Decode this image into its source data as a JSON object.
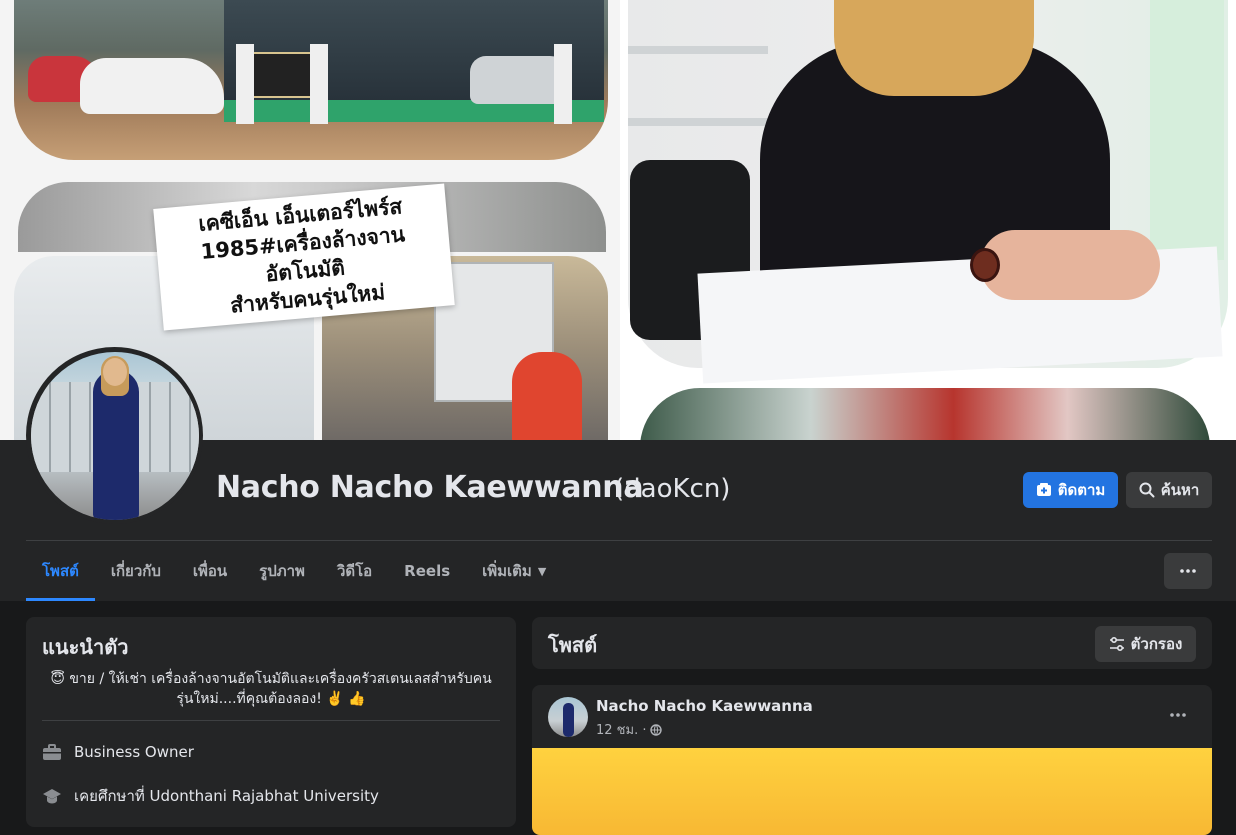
{
  "profile": {
    "name": "Nacho Nacho Kaewwanna",
    "alternate_name": "(daoKcn)"
  },
  "cover": {
    "banner_lines": [
      "เคซีเอ็น เอ็นเตอร์ไพร์ส",
      "1985#เครื่องล้างจานอัตโนมัติ",
      "สำหรับคนรุ่นใหม่"
    ]
  },
  "actions": {
    "follow_label": "ติดตาม",
    "search_label": "ค้นหา"
  },
  "tabs": [
    {
      "label": "โพสต์",
      "active": true
    },
    {
      "label": "เกี่ยวกับ",
      "active": false
    },
    {
      "label": "เพื่อน",
      "active": false
    },
    {
      "label": "รูปภาพ",
      "active": false
    },
    {
      "label": "วิดีโอ",
      "active": false
    },
    {
      "label": "Reels",
      "active": false
    },
    {
      "label": "เพิ่มเติม",
      "active": false
    }
  ],
  "intro": {
    "title": "แนะนำตัว",
    "bio_line1": "😇 ขาย / ให้เช่า เครื่องล้างจานอัตโนมัติและเครื่องครัวสเตนเลสสำหรับคน",
    "bio_line2": "รุ่นใหม่....ที่คุณต้องลอง! ✌️ 👍",
    "work": "Business Owner",
    "education": "เคยศึกษาที่ Udonthani Rajabhat University"
  },
  "posts_section": {
    "title": "โพสต์",
    "filter_label": "ตัวกรอง"
  },
  "post": {
    "author": "Nacho Nacho Kaewwanna",
    "time": "12 ชม. ·"
  },
  "colors": {
    "accent": "#2374e1",
    "active_tab": "#2d88ff",
    "surface": "#242526",
    "background": "#18191a"
  }
}
